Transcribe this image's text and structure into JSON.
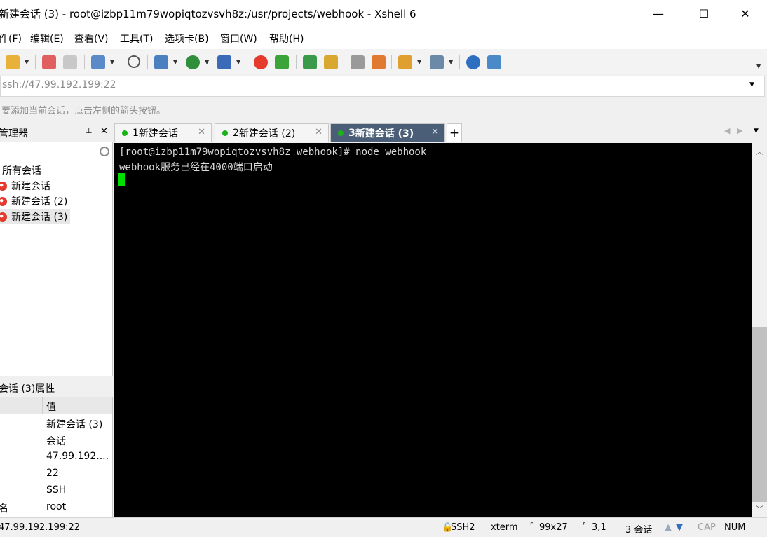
{
  "window": {
    "title": "新建会话 (3) - root@izbp11m79wopiqtozvsvh8z:/usr/projects/webhook - Xshell 6",
    "minimize": "—",
    "maximize": "☐",
    "close": "✕"
  },
  "menu": [
    "件(F)",
    "编辑(E)",
    "查看(V)",
    "工具(T)",
    "选项卡(B)",
    "窗口(W)",
    "帮助(H)"
  ],
  "address": {
    "value": "ssh://47.99.192.199:22"
  },
  "hint": "要添加当前会话，点击左侧的箭头按钮。",
  "session_manager": {
    "title": "管理器",
    "pin": "📌",
    "close": "✕",
    "root": "所有会话",
    "items": [
      "新建会话",
      "新建会话 (2)",
      "新建会话 (3)"
    ]
  },
  "properties": {
    "title": "会话 (3)属性",
    "value_header": "值",
    "rows": [
      {
        "name": "",
        "value": "新建会话 (3)"
      },
      {
        "name": "",
        "value": "会话"
      },
      {
        "name": "",
        "value": "47.99.192...."
      },
      {
        "name": "",
        "value": "22"
      },
      {
        "name": "",
        "value": "SSH"
      },
      {
        "name": "名",
        "value": "root"
      }
    ]
  },
  "tabs": [
    {
      "num": "1",
      "label": " 新建会话"
    },
    {
      "num": "2",
      "label": " 新建会话 (2)"
    },
    {
      "num": "3",
      "label": " 新建会话 (3)"
    }
  ],
  "terminal": {
    "lines": [
      "[root@izbp11m79wopiqtozvsvh8z webhook]# node webhook",
      "webhook服务已经在4000端口启动"
    ]
  },
  "status": {
    "host": "47.99.192.199:22",
    "protocol": "SSH2",
    "term": "xterm",
    "size": "99x27",
    "pos": "3,1",
    "sessions": "3 会话",
    "cap": "CAP",
    "num": "NUM"
  },
  "colors": {
    "active_tab": "#4a5f77",
    "tab_dot": "#19b219",
    "cursor": "#00e000"
  }
}
